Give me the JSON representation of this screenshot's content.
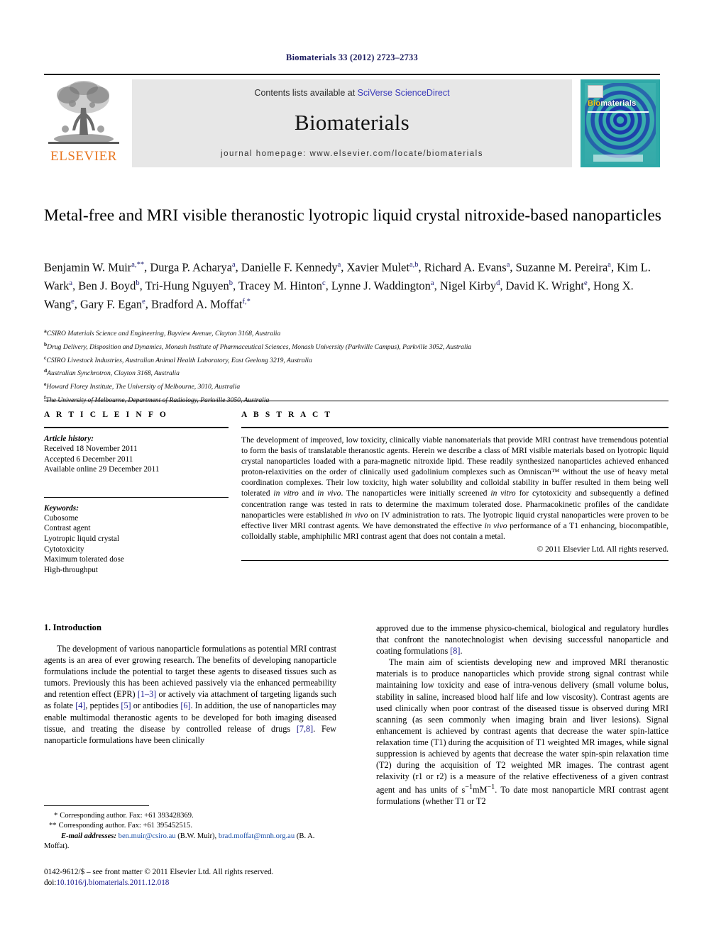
{
  "running_head": "Biomaterials 33 (2012) 2723–2733",
  "masthead": {
    "contents_prefix": "Contents lists available at ",
    "sciencedirect": "SciVerse ScienceDirect",
    "journal_name": "Biomaterials",
    "homepage": "journal homepage: www.elsevier.com/locate/biomaterials",
    "publisher": "ELSEVIER",
    "cover_title_bi": "Bio",
    "cover_title_rest": "materials",
    "colors": {
      "band_bg": "#e7e7e7",
      "link_blue": "#3b3bbb",
      "elsevier_orange": "#E87722",
      "cover_teal": "#2fa9a8"
    }
  },
  "title": "Metal-free and MRI visible theranostic lyotropic liquid crystal nitroxide-based nanoparticles",
  "authors_html": "Benjamin W. Muir<sup>a,**</sup>, Durga P. Acharya<sup>a</sup>, Danielle F. Kennedy<sup>a</sup>, Xavier Mulet<sup>a,b</sup>, Richard A. Evans<sup>a</sup>, Suzanne M. Pereira<sup>a</sup>, Kim L. Wark<sup>a</sup>, Ben J. Boyd<sup>b</sup>, Tri-Hung Nguyen<sup>b</sup>, Tracey M. Hinton<sup>c</sup>, Lynne J. Waddington<sup>a</sup>, Nigel Kirby<sup>d</sup>, David K. Wright<sup>e</sup>, Hong X. Wang<sup>e</sup>, Gary F. Egan<sup>e</sup>, Bradford A. Moffat<sup>f,*</sup>",
  "affiliations": [
    {
      "mark": "a",
      "text": "CSIRO Materials Science and Engineering, Bayview Avenue, Clayton 3168, Australia"
    },
    {
      "mark": "b",
      "text": "Drug Delivery, Disposition and Dynamics, Monash Institute of Pharmaceutical Sciences, Monash University (Parkville Campus), Parkville 3052, Australia"
    },
    {
      "mark": "c",
      "text": "CSIRO Livestock Industries, Australian Animal Health Laboratory, East Geelong 3219, Australia"
    },
    {
      "mark": "d",
      "text": "Australian Synchrotron, Clayton 3168, Australia"
    },
    {
      "mark": "e",
      "text": "Howard Florey Institute, The University of Melbourne, 3010, Australia"
    },
    {
      "mark": "f",
      "text": "The University of Melbourne, Department of Radiology, Parkville 3050, Australia"
    }
  ],
  "article_info": {
    "heading": "A R T I C L E   I N F O",
    "history_label": "Article history:",
    "history": [
      "Received 18 November 2011",
      "Accepted 6 December 2011",
      "Available online 29 December 2011"
    ],
    "keywords_label": "Keywords:",
    "keywords": [
      "Cubosome",
      "Contrast agent",
      "Lyotropic liquid crystal",
      "Cytotoxicity",
      "Maximum tolerated dose",
      "High-throughput"
    ]
  },
  "abstract": {
    "heading": "A B S T R A C T",
    "text_html": "The development of improved, low toxicity, clinically viable nanomaterials that provide MRI contrast have tremendous potential to form the basis of translatable theranostic agents. Herein we describe a class of MRI visible materials based on lyotropic liquid crystal nanoparticles loaded with a para-magnetic nitroxide lipid. These readily synthesized nanoparticles achieved enhanced proton-relaxivities on the order of clinically used gadolinium complexes such as Omniscan™ without the use of heavy metal coordination complexes. Their low toxicity, high water solubility and colloidal stability in buffer resulted in them being well tolerated <i>in vitro</i> and <i>in vivo</i>. The nanoparticles were initially screened <i>in vitro</i> for cytotoxicity and subsequently a defined concentration range was tested in rats to determine the maximum tolerated dose. Pharmacokinetic profiles of the candidate nanoparticles were established <i>in vivo</i> on IV administration to rats. The lyotropic liquid crystal nanoparticles were proven to be effective liver MRI contrast agents. We have demonstrated the effective <i>in vivo</i> performance of a T1 enhancing, biocompatible, colloidally stable, amphiphilic MRI contrast agent that does not contain a metal.",
    "copyright": "© 2011 Elsevier Ltd. All rights reserved."
  },
  "introduction": {
    "heading": "1.  Introduction",
    "left_p1_html": "The development of various nanoparticle formulations as potential MRI contrast agents is an area of ever growing research. The benefits of developing nanoparticle formulations include the potential to target these agents to diseased tissues such as tumors. Previously this has been achieved passively via the enhanced permeability and retention effect (EPR) <span class=\"ref\">[1–3]</span> or actively via attachment of targeting ligands such as folate <span class=\"ref\">[4]</span>, peptides <span class=\"ref\">[5]</span> or antibodies <span class=\"ref\">[6]</span>. In addition, the use of nanoparticles may enable multimodal theranostic agents to be developed for both imaging diseased tissue, and treating the disease by controlled release of drugs <span class=\"ref\">[7,8]</span>. Few nanoparticle formulations have been clinically",
    "right_p1_html": "approved due to the immense physico-chemical, biological and regulatory hurdles that confront the nanotechnologist when devising successful nanoparticle and coating formulations <span class=\"ref\">[8]</span>.",
    "right_p2_html": "The main aim of scientists developing new and improved MRI theranostic materials is to produce nanoparticles which provide strong signal contrast while maintaining low toxicity and ease of intra-venous delivery (small volume bolus, stability in saline, increased blood half life and low viscosity). Contrast agents are used clinically when poor contrast of the diseased tissue is observed during MRI scanning (as seen commonly when imaging brain and liver lesions). Signal enhancement is achieved by contrast agents that decrease the water spin-lattice relaxation time (T1) during the acquisition of T1 weighted MR images, while signal suppression is achieved by agents that decrease the water spin-spin relaxation time (T2) during the acquisition of T2 weighted MR images. The contrast agent relaxivity (r1 or r2) is a measure of the relative effectiveness of a given contrast agent and has units of s<sup>−1</sup>mM<sup>−1</sup>. To date most nanoparticle MRI contrast agent formulations (whether T1 or T2"
  },
  "footnotes": {
    "corresponding_1_mark": "*",
    "corresponding_1": "Corresponding author. Fax: +61 393428369.",
    "corresponding_2_mark": "**",
    "corresponding_2": "Corresponding author. Fax: +61 395452515.",
    "email_label": "E-mail addresses:",
    "email_1": "ben.muir@csiro.au",
    "email_1_who": "(B.W. Muir),",
    "email_2": "brad.moffat@mnh.org.au",
    "email_2_who": "(B. A. Moffat)."
  },
  "imprint": {
    "issn_line": "0142-9612/$ – see front matter © 2011 Elsevier Ltd. All rights reserved.",
    "doi_prefix": "doi:",
    "doi": "10.1016/j.biomaterials.2011.12.018"
  }
}
